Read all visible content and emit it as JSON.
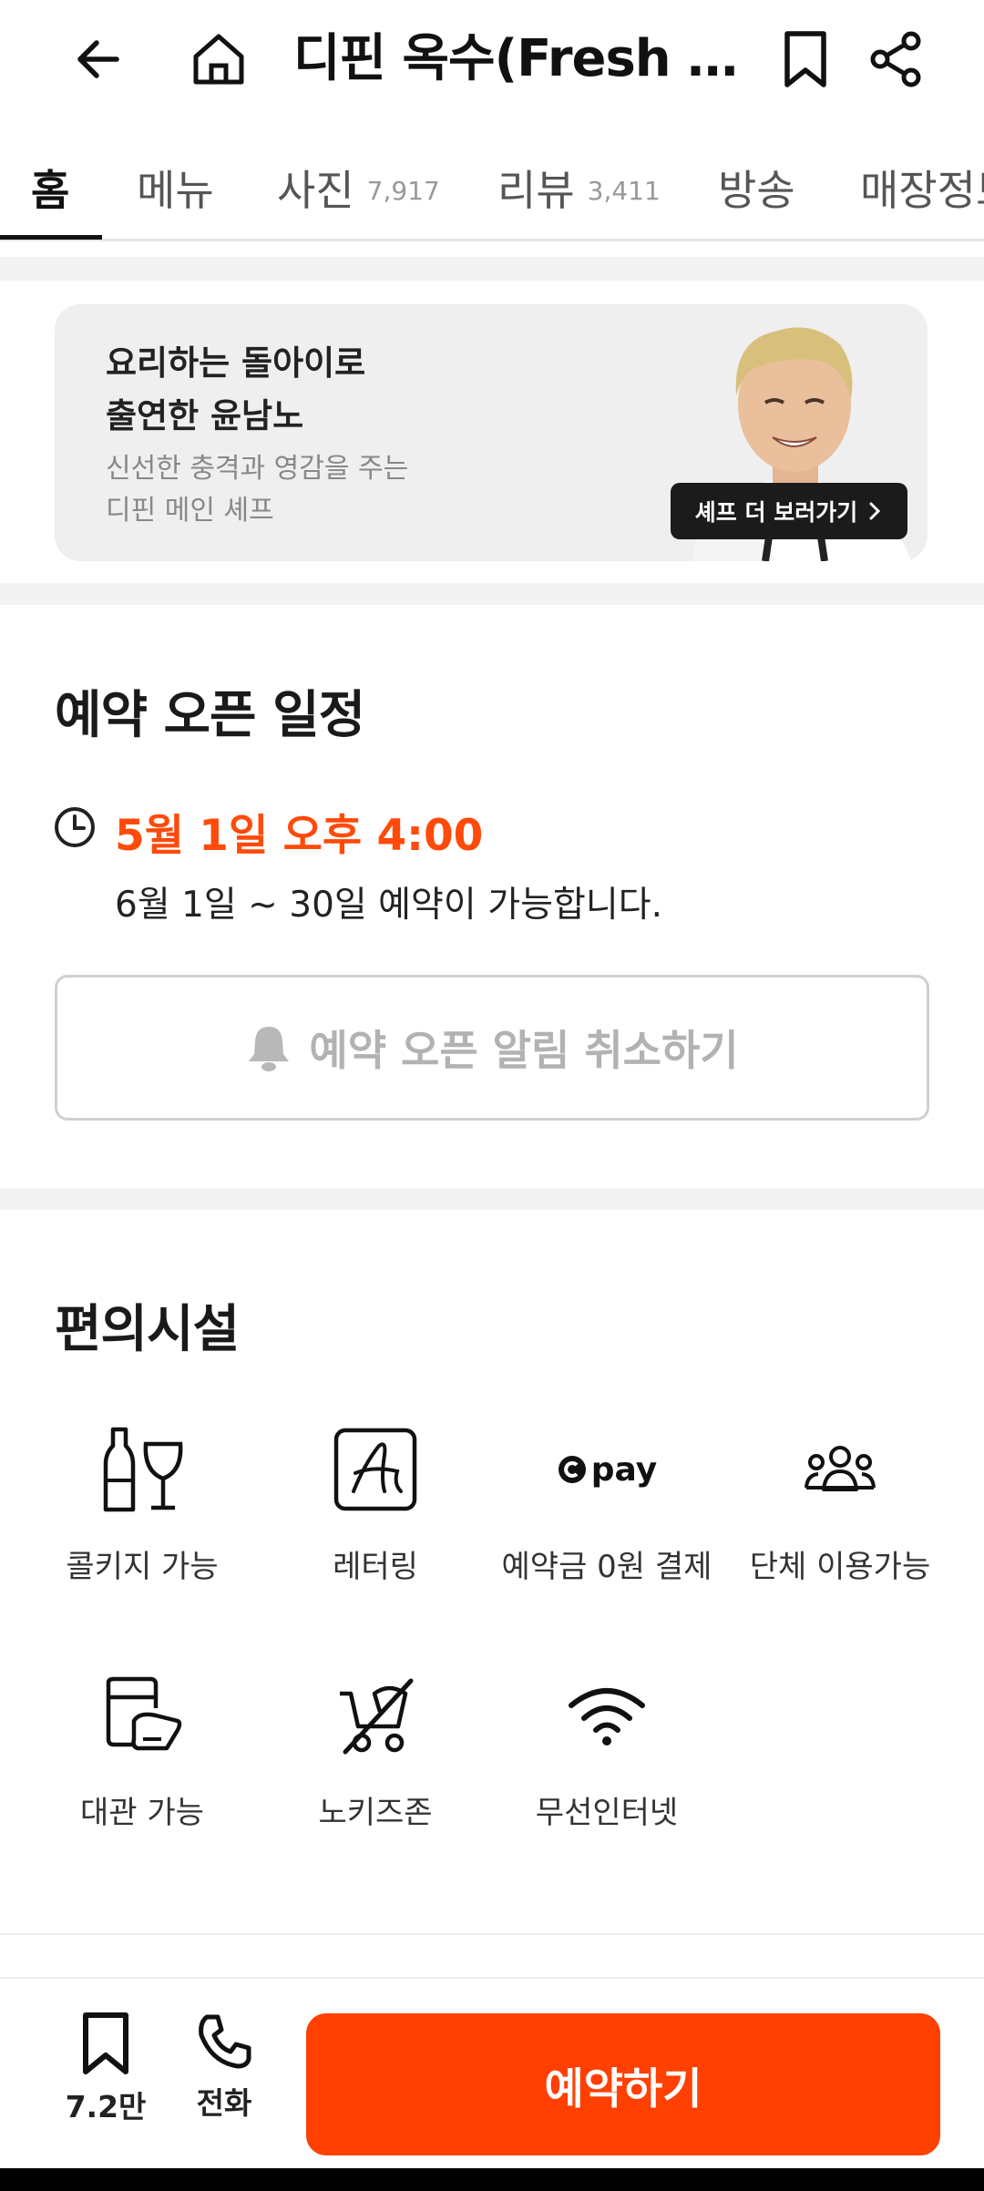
{
  "header": {
    "title": "디핀 옥수(Fresh P...",
    "back_icon": "arrow-left-icon",
    "home_icon": "home-icon",
    "bookmark_icon": "bookmark-icon",
    "share_icon": "share-icon"
  },
  "tabs": [
    {
      "label": "홈",
      "count": "",
      "active": true
    },
    {
      "label": "메뉴",
      "count": ""
    },
    {
      "label": "사진",
      "count": "7,917"
    },
    {
      "label": "리뷰",
      "count": "3,411"
    },
    {
      "label": "방송",
      "count": ""
    },
    {
      "label": "매장정보",
      "count": ""
    }
  ],
  "banner": {
    "title_line1": "요리하는 돌아이로",
    "title_line2": "출연한 윤남노",
    "sub_line1": "신선한 충격과 영감을 주는",
    "sub_line2": "디핀 메인 셰프",
    "button_label": "셰프 더 보러가기"
  },
  "schedule": {
    "title": "예약 오픈 일정",
    "open_time": "5월 1일 오후 4:00",
    "description": "6월 1일 ~ 30일 예약이 가능합니다.",
    "notify_button": "예약 오픈 알림 취소하기"
  },
  "amenities": {
    "title": "편의시설",
    "items": [
      {
        "label": "콜키지 가능",
        "icon": "wine-bottle-glass-icon"
      },
      {
        "label": "레터링",
        "icon": "lettering-icon"
      },
      {
        "label": "예약금 0원 결제",
        "icon": "pay-icon",
        "icon_text": "pay"
      },
      {
        "label": "단체 이용가능",
        "icon": "group-icon"
      },
      {
        "label": "대관 가능",
        "icon": "venue-rental-icon"
      },
      {
        "label": "노키즈존",
        "icon": "no-stroller-icon"
      },
      {
        "label": "무선인터넷",
        "icon": "wifi-icon"
      }
    ]
  },
  "bottom_bar": {
    "bookmark_count": "7.2만",
    "call_label": "전화",
    "reserve_label": "예약하기"
  },
  "colors": {
    "accent": "#ff4000",
    "open_time": "#ff4a0a"
  }
}
